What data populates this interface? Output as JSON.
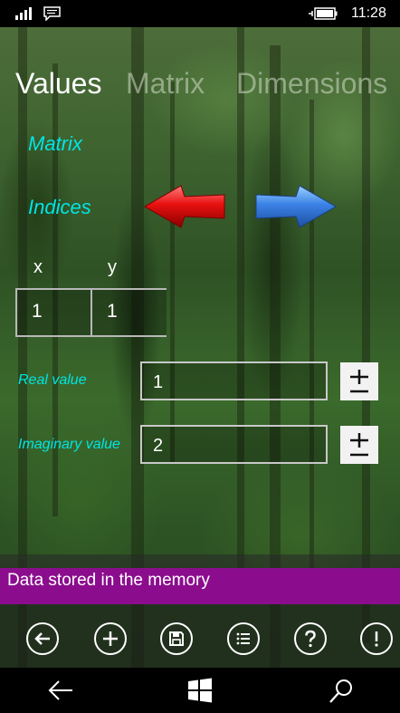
{
  "status_bar": {
    "time": "11:28"
  },
  "pivot": {
    "tabs": [
      {
        "label": "Values"
      },
      {
        "label": "Matrix"
      },
      {
        "label": "Dimensions"
      }
    ],
    "active_index": 0
  },
  "labels": {
    "matrix": "Matrix",
    "indices": "Indices",
    "x": "x",
    "y": "y",
    "real_value": "Real value",
    "imaginary_value": "Imaginary value"
  },
  "inputs": {
    "index_x": "1",
    "index_y": "1",
    "real_value": "1",
    "imaginary_value": "2"
  },
  "buttons": {
    "plus_minus_symbol": "±"
  },
  "status_message": "Data stored in the memory",
  "app_bar": {
    "icons": [
      "back-icon",
      "add-icon",
      "save-icon",
      "list-icon",
      "help-icon",
      "info-icon"
    ]
  },
  "nav_bar": {
    "icons": [
      "back-arrow-icon",
      "windows-start-icon",
      "search-icon"
    ]
  },
  "colors": {
    "accent_cyan": "#00e5e5",
    "status_banner": "#8b0d8e",
    "arrow_left": "#e01010",
    "arrow_right": "#3a7ee0"
  }
}
